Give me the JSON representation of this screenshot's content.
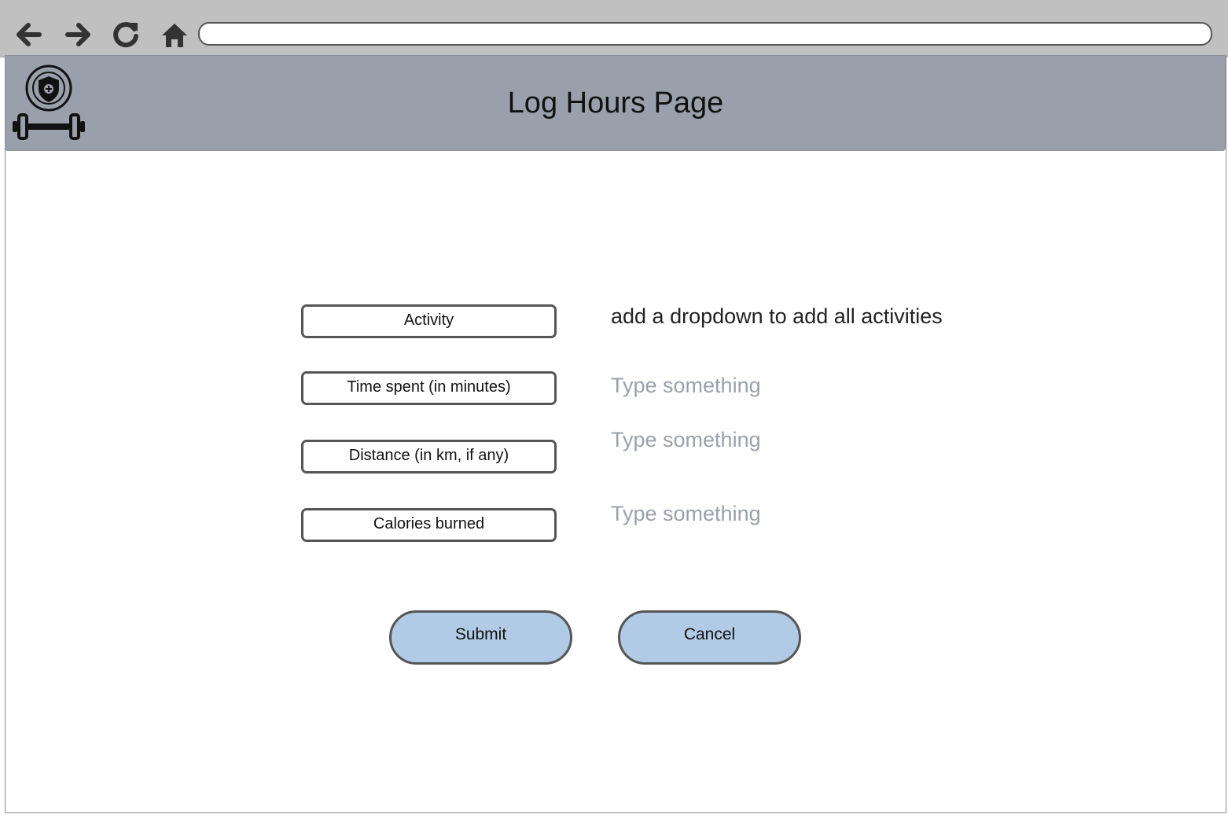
{
  "browser": {
    "address_value": "",
    "nav_icons": [
      "back-arrow-icon",
      "forward-arrow-icon",
      "reload-icon",
      "home-icon"
    ]
  },
  "header": {
    "title": "Log Hours Page",
    "logo_icon": "shield-dumbbell-logo",
    "background_color": "#9aa0ab"
  },
  "form": {
    "fields": [
      {
        "label": "Activity",
        "note": "add a dropdown to add all activities"
      },
      {
        "label": "Time spent (in minutes)",
        "placeholder": "Type something",
        "value": ""
      },
      {
        "label": "Distance (in km, if any)",
        "placeholder": "Type something",
        "value": ""
      },
      {
        "label": "Calories burned",
        "placeholder": "Type something",
        "value": ""
      }
    ]
  },
  "actions": {
    "submit_label": "Submit",
    "cancel_label": "Cancel",
    "button_color": "#b1cbe6"
  }
}
